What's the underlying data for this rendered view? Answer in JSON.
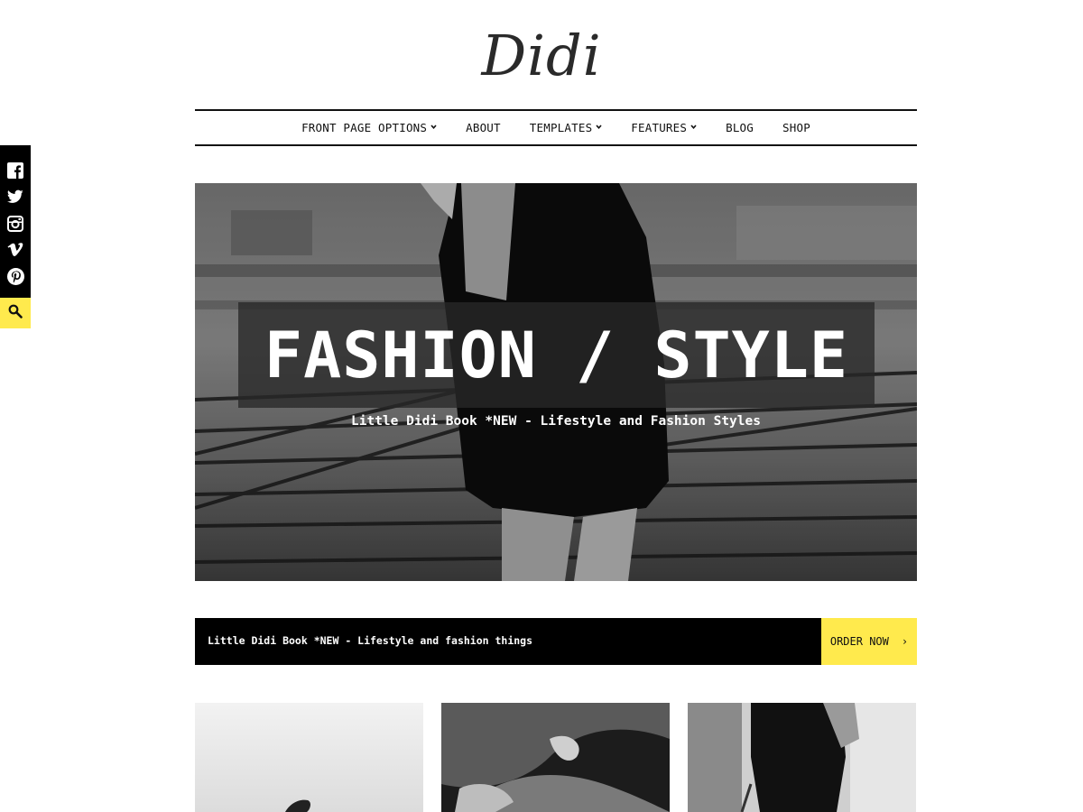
{
  "site": {
    "logo": "Didi"
  },
  "nav": [
    {
      "label": "FRONT PAGE OPTIONS",
      "has_dropdown": true
    },
    {
      "label": "ABOUT",
      "has_dropdown": false
    },
    {
      "label": "TEMPLATES",
      "has_dropdown": true
    },
    {
      "label": "FEATURES",
      "has_dropdown": true
    },
    {
      "label": "BLOG",
      "has_dropdown": false
    },
    {
      "label": "SHOP",
      "has_dropdown": false
    }
  ],
  "social": {
    "icons": [
      "facebook-icon",
      "twitter-icon",
      "instagram-icon",
      "vimeo-icon",
      "pinterest-icon"
    ],
    "search_icon": "search-icon"
  },
  "hero": {
    "title": "FASHION / STYLE",
    "subtitle": "Little Didi Book *NEW - Lifestyle and Fashion Styles"
  },
  "promo": {
    "text": "Little Didi Book *NEW - Lifestyle and fashion things",
    "button_label": "ORDER NOW",
    "button_arrow": "›"
  },
  "colors": {
    "accent": "#ffea4d",
    "dark": "#000000",
    "text": "#111111"
  }
}
